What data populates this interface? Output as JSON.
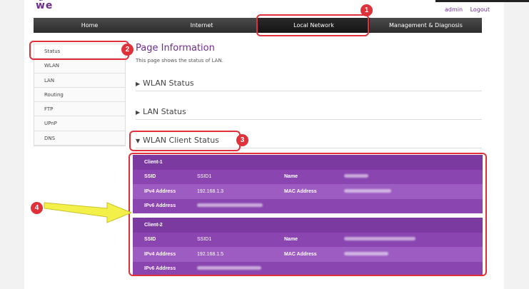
{
  "header": {
    "logo": "we",
    "user": "admin",
    "logout": "Logout"
  },
  "nav": [
    "Home",
    "Internet",
    "Local Network",
    "Management & Diagnosis"
  ],
  "sidebar": [
    "Status",
    "WLAN",
    "LAN",
    "Routing",
    "FTP",
    "UPnP",
    "DNS"
  ],
  "page": {
    "title": "Page Information",
    "desc": "This page shows the status of LAN."
  },
  "sections": [
    "WLAN Status",
    "LAN Status",
    "WLAN Client Status"
  ],
  "clients": [
    {
      "title": "Client-1",
      "ssid_label": "SSID",
      "ssid": "SSID1",
      "name_label": "Name",
      "ipv4_label": "IPv4 Address",
      "ipv4": "192.168.1.3",
      "mac_label": "MAC Address",
      "ipv6_label": "IPv6 Address"
    },
    {
      "title": "Client-2",
      "ssid_label": "SSID",
      "ssid": "SSID1",
      "name_label": "Name",
      "ipv4_label": "IPv4 Address",
      "ipv4": "192.168.1.5",
      "mac_label": "MAC Address",
      "ipv6_label": "IPv6 Address"
    }
  ],
  "badges": [
    "1",
    "2",
    "3",
    "4"
  ]
}
